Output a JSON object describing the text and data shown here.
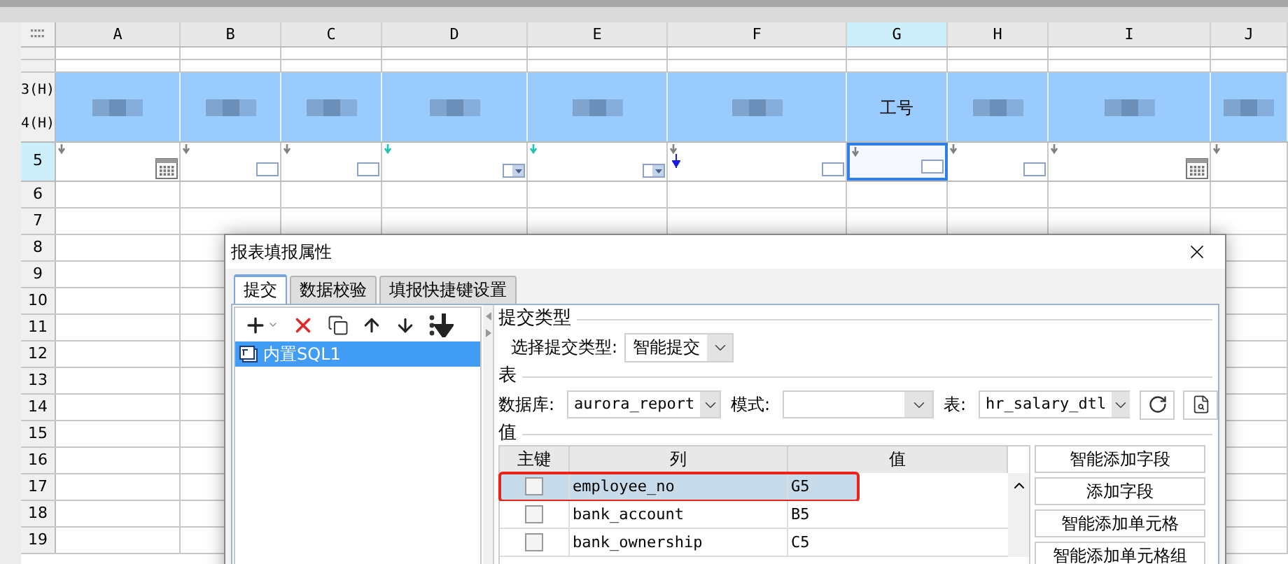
{
  "sheet": {
    "columns": [
      {
        "label": "A",
        "selected": false
      },
      {
        "label": "B",
        "selected": false
      },
      {
        "label": "C",
        "selected": false
      },
      {
        "label": "D",
        "selected": false
      },
      {
        "label": "E",
        "selected": false
      },
      {
        "label": "F",
        "selected": false
      },
      {
        "label": "G",
        "selected": true
      },
      {
        "label": "H",
        "selected": false
      },
      {
        "label": "I",
        "selected": false
      },
      {
        "label": "J",
        "selected": false
      }
    ],
    "band": {
      "row_labels": [
        "3(H)",
        "4(H)"
      ],
      "cells": [
        {
          "kind": "redacted"
        },
        {
          "kind": "redacted"
        },
        {
          "kind": "redacted"
        },
        {
          "kind": "redacted"
        },
        {
          "kind": "redacted"
        },
        {
          "kind": "redacted"
        },
        {
          "kind": "text",
          "text": "工号"
        },
        {
          "kind": "redacted"
        },
        {
          "kind": "redacted"
        },
        {
          "kind": "redacted"
        }
      ]
    },
    "input_row": {
      "label": "5",
      "selected": true,
      "cells": [
        {
          "kind": "date",
          "color": "#808080",
          "selected": false,
          "arrow": false
        },
        {
          "kind": "textbox",
          "color": "#808080",
          "selected": false,
          "arrow": false
        },
        {
          "kind": "textbox",
          "color": "#808080",
          "selected": false,
          "arrow": false
        },
        {
          "kind": "dropdown",
          "color": "#22c4b0",
          "selected": false,
          "arrow": false
        },
        {
          "kind": "dropdown",
          "color": "#22c4b0",
          "selected": false,
          "arrow": false
        },
        {
          "kind": "textbox",
          "color": "#808080",
          "selected": false,
          "arrow": true
        },
        {
          "kind": "textbox",
          "color": "#808080",
          "selected": true,
          "arrow": false
        },
        {
          "kind": "textbox",
          "color": "#808080",
          "selected": false,
          "arrow": false
        },
        {
          "kind": "date",
          "color": "#808080",
          "selected": false,
          "arrow": false
        },
        {
          "kind": "none",
          "color": "#808080",
          "selected": false,
          "arrow": false
        }
      ]
    },
    "rows": [
      {
        "label": "6"
      },
      {
        "label": "7"
      },
      {
        "label": "8"
      },
      {
        "label": "9"
      },
      {
        "label": "10"
      },
      {
        "label": "11"
      },
      {
        "label": "12"
      },
      {
        "label": "13"
      },
      {
        "label": "14"
      },
      {
        "label": "15"
      },
      {
        "label": "16"
      },
      {
        "label": "17"
      },
      {
        "label": "18"
      },
      {
        "label": "19"
      }
    ]
  },
  "dialog": {
    "title": "报表填报属性",
    "tabs": [
      {
        "label": "提交",
        "selected": true
      },
      {
        "label": "数据校验",
        "selected": false
      },
      {
        "label": "填报快捷键设置",
        "selected": false
      }
    ],
    "list_items": [
      {
        "label": "内置SQL1",
        "selected": true
      }
    ],
    "submit_type": {
      "legend": "提交类型",
      "label": "选择提交类型:",
      "value": "智能提交"
    },
    "table_section": {
      "legend": "表",
      "database_label": "数据库:",
      "database_value": "aurora_report",
      "schema_label": "模式:",
      "table_label": "表:",
      "table_value": "hr_salary_dtl"
    },
    "values": {
      "legend": "值",
      "columns": [
        "主键",
        "列",
        "值"
      ],
      "rows": [
        {
          "checked": false,
          "column": "employee_no",
          "value": "G5",
          "selected": true,
          "highlighted": true
        },
        {
          "checked": false,
          "column": "bank_account",
          "value": "B5",
          "selected": false,
          "highlighted": false
        },
        {
          "checked": false,
          "column": "bank_ownership",
          "value": "C5",
          "selected": false,
          "highlighted": false
        }
      ]
    },
    "buttons": [
      "智能添加字段",
      "添加字段",
      "智能添加单元格",
      "智能添加单元格组"
    ]
  }
}
